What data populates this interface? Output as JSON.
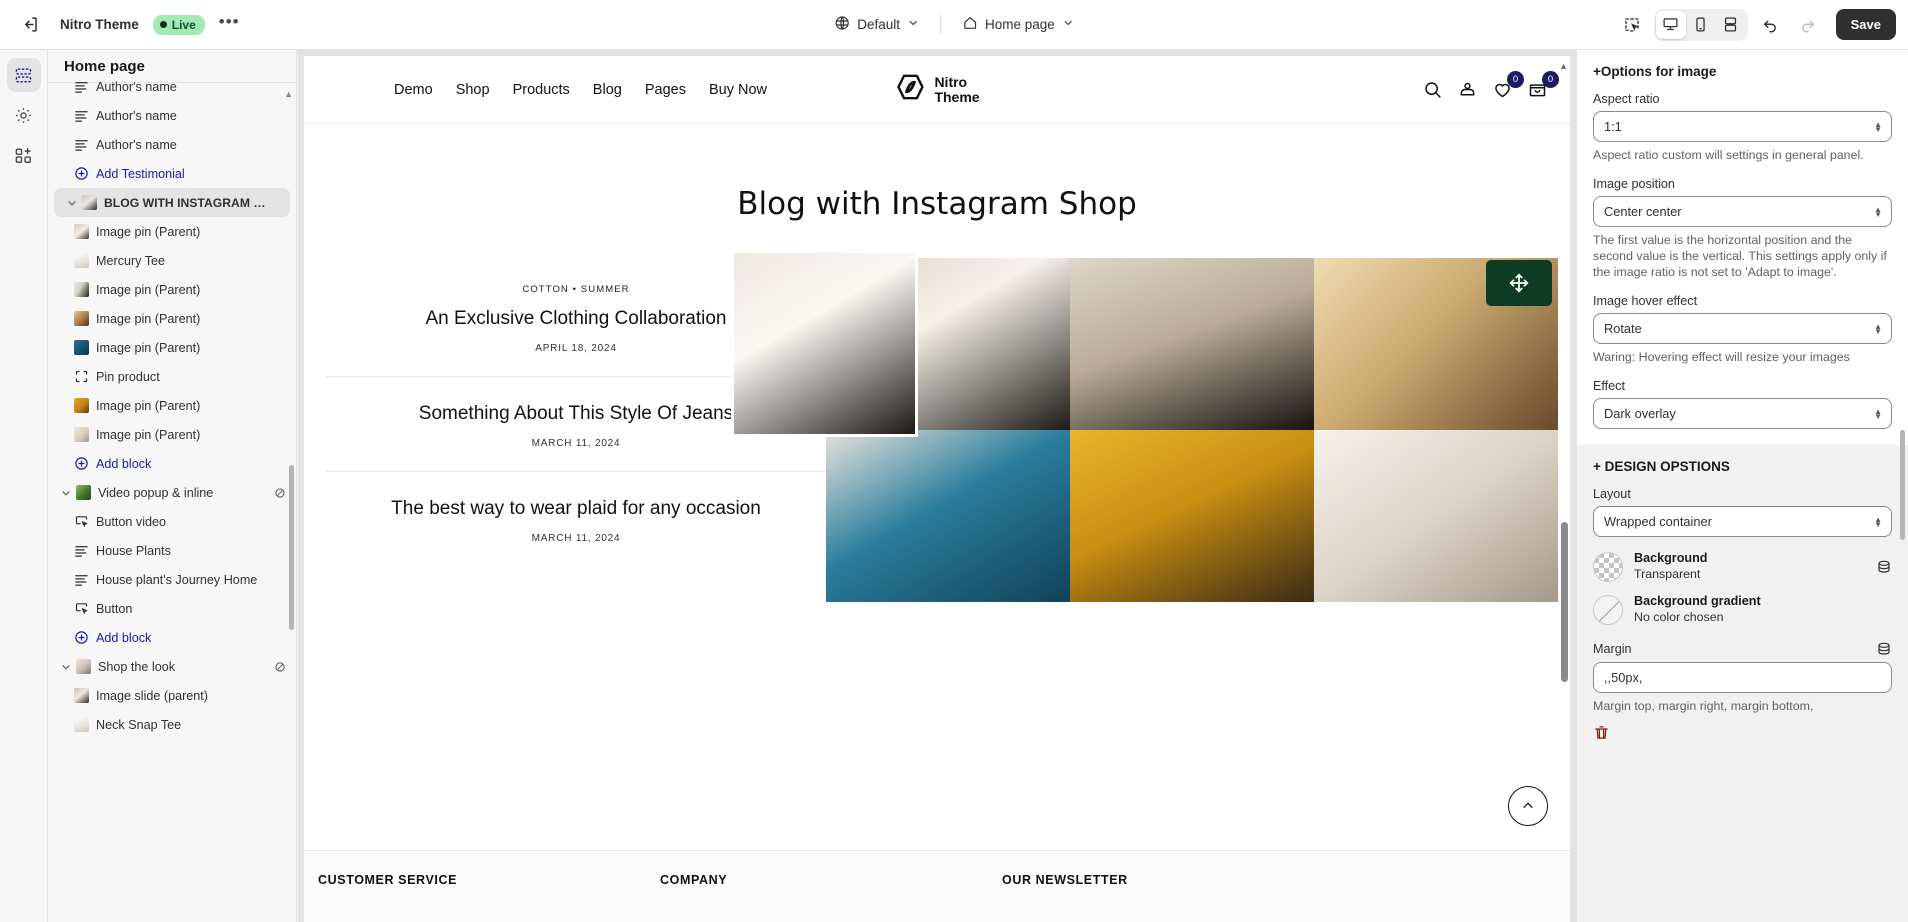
{
  "topbar": {
    "exit_icon": "exit-icon",
    "theme_name": "Nitro Theme",
    "live_label": "Live",
    "more_label": "•••",
    "template_selector": {
      "icon": "globe-icon",
      "label": "Default"
    },
    "page_selector": {
      "icon": "home-icon",
      "label": "Home page"
    },
    "inspector_icon": "inspector-icon",
    "devices": [
      {
        "name": "desktop",
        "icon": "desktop-icon",
        "active": true
      },
      {
        "name": "mobile",
        "icon": "mobile-icon",
        "active": false
      },
      {
        "name": "fullscreen",
        "icon": "fullscreen-icon",
        "active": false
      }
    ],
    "undo_icon": "undo-icon",
    "redo_icon": "redo-icon",
    "save_label": "Save"
  },
  "rail": {
    "items": [
      {
        "name": "sections",
        "icon": "sections-icon",
        "active": true
      },
      {
        "name": "settings",
        "icon": "gear-icon",
        "active": false
      },
      {
        "name": "apps",
        "icon": "apps-add-icon",
        "active": false
      }
    ]
  },
  "left_panel": {
    "title": "Home page",
    "tree": [
      {
        "label": "Author's name",
        "icon": "text-lines-icon",
        "indent": 2,
        "type": "block",
        "partial": true
      },
      {
        "label": "Author's name",
        "icon": "text-lines-icon",
        "indent": 2,
        "type": "block"
      },
      {
        "label": "Author's name",
        "icon": "text-lines-icon",
        "indent": 2,
        "type": "block"
      },
      {
        "label": "Add Testimonial",
        "icon": "plus-circle-icon",
        "indent": 2,
        "type": "add"
      },
      {
        "label": "BLOG WITH INSTAGRAM SHOP",
        "icon": "thumb",
        "thumb": "th-a",
        "indent": 1,
        "type": "section",
        "selected": true,
        "caret": true
      },
      {
        "label": "Image pin (Parent)",
        "icon": "thumb",
        "thumb": "th-i",
        "indent": 2,
        "type": "block"
      },
      {
        "label": "Mercury Tee",
        "icon": "thumb",
        "thumb": "th-b",
        "indent": 2,
        "type": "block"
      },
      {
        "label": "Image pin (Parent)",
        "icon": "thumb",
        "thumb": "th-c",
        "indent": 2,
        "type": "block"
      },
      {
        "label": "Image pin (Parent)",
        "icon": "thumb",
        "thumb": "th-d",
        "indent": 2,
        "type": "block"
      },
      {
        "label": "Image pin (Parent)",
        "icon": "thumb",
        "thumb": "th-e",
        "indent": 2,
        "type": "block"
      },
      {
        "label": "Pin product",
        "icon": "pin-product-icon",
        "indent": 2,
        "type": "block"
      },
      {
        "label": "Image pin (Parent)",
        "icon": "thumb",
        "thumb": "th-f",
        "indent": 2,
        "type": "block"
      },
      {
        "label": "Image pin (Parent)",
        "icon": "thumb",
        "thumb": "th-g",
        "indent": 2,
        "type": "block"
      },
      {
        "label": "Add block",
        "icon": "plus-circle-icon",
        "indent": 2,
        "type": "add"
      },
      {
        "label": "Video popup & inline",
        "icon": "thumb",
        "thumb": "th-h",
        "indent": 1,
        "type": "section",
        "caret": true,
        "hidden": true
      },
      {
        "label": "Button video",
        "icon": "button-icon",
        "indent": 2,
        "type": "block"
      },
      {
        "label": "House Plants",
        "icon": "text-lines-icon",
        "indent": 2,
        "type": "block"
      },
      {
        "label": "House plant's Journey Home",
        "icon": "text-lines-icon",
        "indent": 2,
        "type": "block"
      },
      {
        "label": "Button",
        "icon": "button-icon",
        "indent": 2,
        "type": "block"
      },
      {
        "label": "Add block",
        "icon": "plus-circle-icon",
        "indent": 2,
        "type": "add"
      },
      {
        "label": "Shop the look",
        "icon": "thumb",
        "thumb": "th-j",
        "indent": 1,
        "type": "section",
        "caret": true,
        "hidden": true
      },
      {
        "label": "Image slide (parent)",
        "icon": "thumb",
        "thumb": "th-a",
        "indent": 2,
        "type": "block"
      },
      {
        "label": "Neck Snap Tee",
        "icon": "thumb",
        "thumb": "th-b",
        "indent": 2,
        "type": "block"
      }
    ]
  },
  "preview": {
    "nav": [
      "Demo",
      "Shop",
      "Products",
      "Blog",
      "Pages",
      "Buy Now"
    ],
    "logo": {
      "line1": "Nitro",
      "line2": "Theme",
      "icon": "nitro-logo-icon"
    },
    "icons": [
      {
        "name": "search-icon",
        "badge": null
      },
      {
        "name": "account-icon",
        "badge": null
      },
      {
        "name": "wishlist-heart-icon",
        "badge": "0"
      },
      {
        "name": "cart-icon",
        "badge": "0"
      }
    ],
    "page_title": "Blog with Instagram Shop",
    "posts": [
      {
        "tags": "COTTON  •  SUMMER",
        "title": "An Exclusive Clothing Collaboration",
        "date": "APRIL 18, 2024"
      },
      {
        "tags": "",
        "title": "Something About This Style Of Jeans",
        "date": "MARCH 11, 2024"
      },
      {
        "tags": "",
        "title": "The best way to wear plaid for any occasion",
        "date": "MARCH 11, 2024"
      }
    ],
    "footer_columns": [
      "CUSTOMER SERVICE",
      "COMPANY",
      "OUR NEWSLETTER"
    ],
    "scroll_top_icon": "chevron-up-icon",
    "selected_overlay_icon": "drag-move-icon",
    "accent_badge_color": "#1e1b66",
    "tag_color": "#0d3b24"
  },
  "right_panel": {
    "section_title": "+Options for image",
    "aspect_ratio": {
      "label": "Aspect ratio",
      "value": "1:1",
      "help": "Aspect ratio custom will settings in general panel."
    },
    "image_position": {
      "label": "Image position",
      "value": "Center center",
      "help": "The first value is the horizontal position and the second value is the vertical. This settings apply only if the image ratio is not set to 'Adapt to image'."
    },
    "image_hover_effect": {
      "label": "Image hover effect",
      "value": "Rotate",
      "help": "Waring: Hovering effect will resize your images"
    },
    "effect": {
      "label": "Effect",
      "value": "Dark overlay"
    },
    "design_title": "+ DESIGN OPSTIONS",
    "layout": {
      "label": "Layout",
      "value": "Wrapped container"
    },
    "background": {
      "title": "Background",
      "sub": "Transparent",
      "icon": "database-icon"
    },
    "background_gradient": {
      "title": "Background gradient",
      "sub": "No color chosen"
    },
    "margin": {
      "label": "Margin",
      "value": ",,50px,",
      "icon": "database-icon",
      "help": "Margin top, margin right, margin bottom,"
    }
  }
}
